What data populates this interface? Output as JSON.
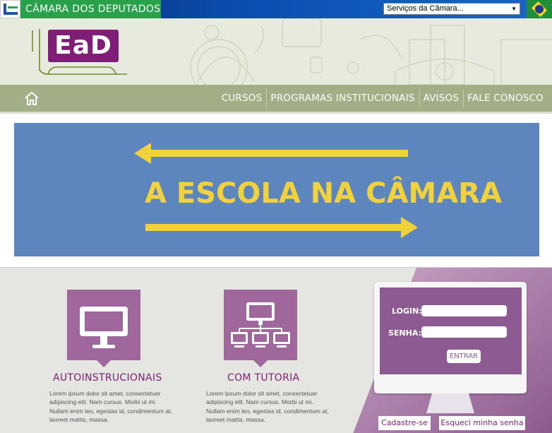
{
  "topbar": {
    "title": "CÂMARA DOS DEPUTADOS",
    "services_select": "Serviços da Câmara...",
    "services_arrow": "▼",
    "colors": {
      "bar": "#0a4fb0",
      "title_bg": "#27a14a"
    }
  },
  "header": {
    "logo_text": "EaD",
    "colors": {
      "bg": "#e7ebdd",
      "logo": "#7e1e77"
    }
  },
  "nav": {
    "home_icon": "home-icon",
    "items": [
      "CURSOS",
      "PROGRAMAS INSTITUCIONAIS",
      "AVISOS",
      "FALE CONOSCO"
    ],
    "colors": {
      "bg": "#a2ae85"
    }
  },
  "hero": {
    "title": "A ESCOLA NA CÂMARA",
    "colors": {
      "bg": "#5d86be",
      "text": "#f2d23b"
    }
  },
  "categories": [
    {
      "icon": "monitor-icon",
      "label": "AUTOINSTRUCIONAIS",
      "text": "Lorem ipsum dolor sit amet, consectetuer adipiscing elit. Nam cursus. Morbi ut mi. Nullam enim leo, egestas id, condimentum at, laoreet mattis, massa."
    },
    {
      "icon": "network-icon",
      "label": "COM TUTORIA",
      "text": "Lorem ipsum dolor sit amet, consectetuer adipiscing elit. Nam cursus. Morbi ut mi. Nullam enim leo, egestas id, condimentum at, laoreet mattis, massa."
    }
  ],
  "login": {
    "login_label": "LOGIN:",
    "password_label": "SENHA:",
    "login_value": "",
    "password_value": "",
    "submit_label": "ENTRAR",
    "register_label": "Cadastre-se",
    "forgot_label": "Esqueci minha senha",
    "colors": {
      "screen": "#8d5a91"
    }
  }
}
